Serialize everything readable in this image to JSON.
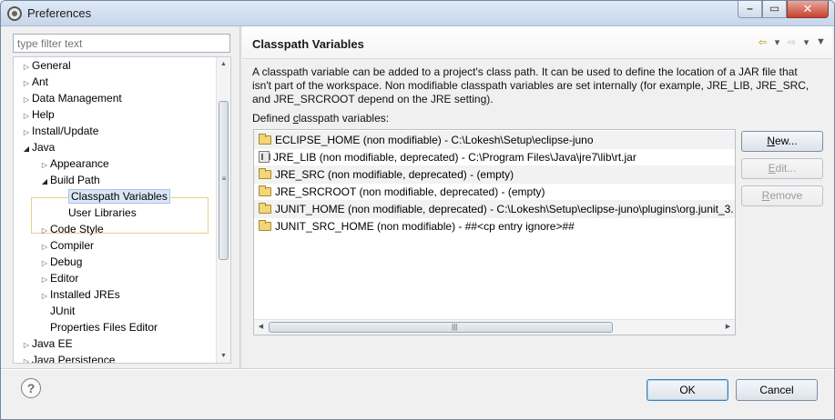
{
  "window": {
    "title": "Preferences"
  },
  "filter": {
    "placeholder": "type filter text"
  },
  "tree": {
    "items": [
      {
        "label": "General",
        "level": 0,
        "twisty": "closed"
      },
      {
        "label": "Ant",
        "level": 0,
        "twisty": "closed"
      },
      {
        "label": "Data Management",
        "level": 0,
        "twisty": "closed"
      },
      {
        "label": "Help",
        "level": 0,
        "twisty": "closed"
      },
      {
        "label": "Install/Update",
        "level": 0,
        "twisty": "closed"
      },
      {
        "label": "Java",
        "level": 0,
        "twisty": "open"
      },
      {
        "label": "Appearance",
        "level": 1,
        "twisty": "closed"
      },
      {
        "label": "Build Path",
        "level": 1,
        "twisty": "open"
      },
      {
        "label": "Classpath Variables",
        "level": 2,
        "twisty": "none",
        "selected": true
      },
      {
        "label": "User Libraries",
        "level": 2,
        "twisty": "none"
      },
      {
        "label": "Code Style",
        "level": 1,
        "twisty": "closed"
      },
      {
        "label": "Compiler",
        "level": 1,
        "twisty": "closed"
      },
      {
        "label": "Debug",
        "level": 1,
        "twisty": "closed"
      },
      {
        "label": "Editor",
        "level": 1,
        "twisty": "closed"
      },
      {
        "label": "Installed JREs",
        "level": 1,
        "twisty": "closed"
      },
      {
        "label": "JUnit",
        "level": 1,
        "twisty": "none"
      },
      {
        "label": "Properties Files Editor",
        "level": 1,
        "twisty": "none"
      },
      {
        "label": "Java EE",
        "level": 0,
        "twisty": "closed"
      },
      {
        "label": "Java Persistence",
        "level": 0,
        "twisty": "closed"
      }
    ]
  },
  "page": {
    "title": "Classpath Variables",
    "description": "A classpath variable can be added to a project's class path. It can be used to define the location of a JAR file that isn't part of the workspace. Non modifiable classpath variables are set internally (for example, JRE_LIB, JRE_SRC, and JRE_SRCROOT depend on the JRE setting).",
    "defined_label_prefix": "Defined ",
    "defined_label_underlined": "c",
    "defined_label_suffix": "lasspath variables:",
    "variables": [
      {
        "icon": "folder-icon",
        "text": "ECLIPSE_HOME (non modifiable) - C:\\Lokesh\\Setup\\eclipse-juno"
      },
      {
        "icon": "jar-icon",
        "text": "JRE_LIB (non modifiable, deprecated) - C:\\Program Files\\Java\\jre7\\lib\\rt.jar"
      },
      {
        "icon": "folder-icon",
        "text": "JRE_SRC (non modifiable, deprecated) - (empty)"
      },
      {
        "icon": "folder-icon",
        "text": "JRE_SRCROOT (non modifiable, deprecated) - (empty)"
      },
      {
        "icon": "folder-icon",
        "text": "JUNIT_HOME (non modifiable, deprecated) - C:\\Lokesh\\Setup\\eclipse-juno\\plugins\\org.junit_3."
      },
      {
        "icon": "folder-icon",
        "text": "JUNIT_SRC_HOME (non modifiable) - ##<cp entry ignore>##"
      }
    ],
    "buttons": {
      "new_u": "N",
      "new_rest": "ew...",
      "edit_u": "E",
      "edit_rest": "dit...",
      "remove_u": "R",
      "remove_rest": "emove"
    }
  },
  "footer": {
    "help": "?",
    "ok": "OK",
    "cancel": "Cancel"
  }
}
